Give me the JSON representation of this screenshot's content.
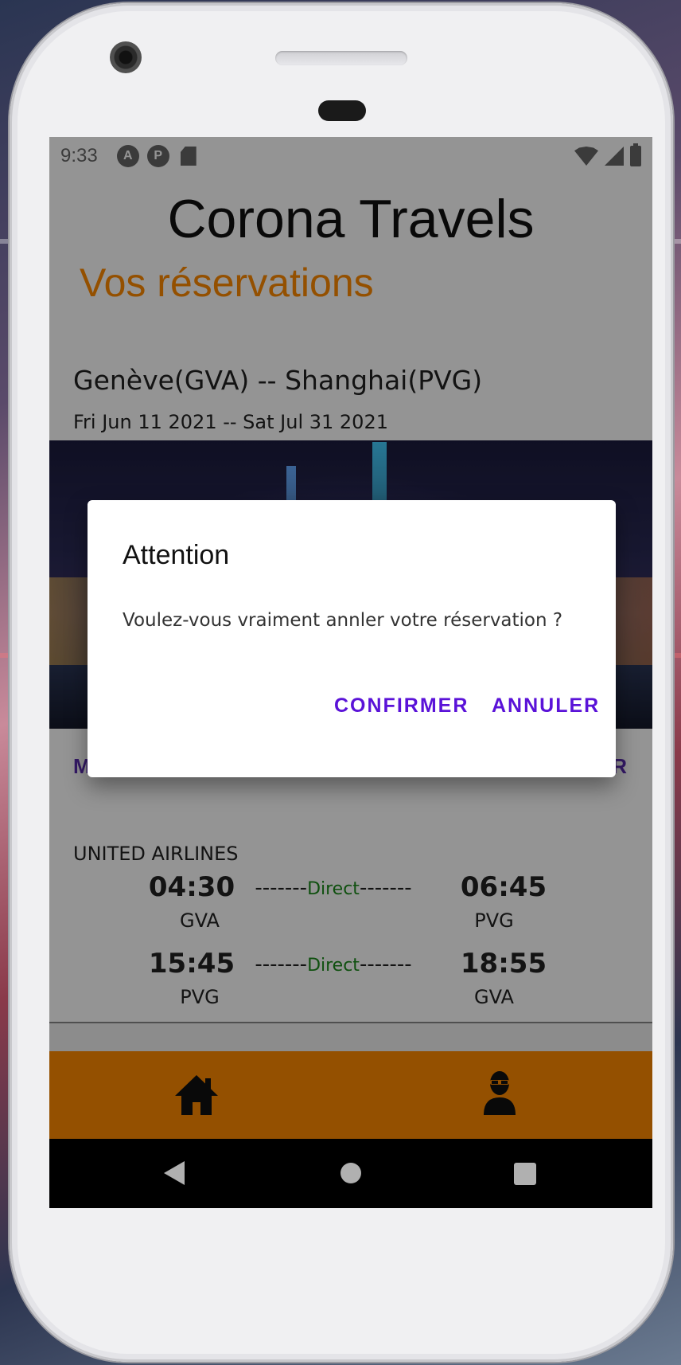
{
  "status_bar": {
    "time": "9:33",
    "notification_icons": [
      "a-letter-icon",
      "p-letter-icon",
      "sd-card-icon"
    ],
    "system_icons": [
      "wifi-icon",
      "signal-icon",
      "battery-icon"
    ]
  },
  "header": {
    "app_title": "Corona Travels",
    "section_title": "Vos réservations",
    "section_title_color": "#ff8a00"
  },
  "reservation": {
    "route": "Genève(GVA) -- Shanghai(PVG)",
    "dates": "Fri Jun 11 2021 -- Sat Jul 31 2021",
    "image": "shanghai-skyline-night",
    "left_action_partial": "M",
    "right_action_partial": "ER"
  },
  "flight": {
    "airline": "UNITED AIRLINES",
    "outbound": {
      "depart_time": "04:30",
      "depart_code": "GVA",
      "arrive_time": "06:45",
      "arrive_code": "PVG",
      "dashes_left": "-------",
      "stop_label": "Direct",
      "dashes_right": "-------"
    },
    "return": {
      "depart_time": "15:45",
      "depart_code": "PVG",
      "arrive_time": "18:55",
      "arrive_code": "GVA",
      "dashes_left": "-------",
      "stop_label": "Direct",
      "dashes_right": "-------"
    }
  },
  "dialog": {
    "title": "Attention",
    "message": "Voulez-vous vraiment annler votre réservation ?",
    "confirm_label": "CONFIRMER",
    "cancel_label": "ANNULER",
    "button_color": "#5a12d8"
  },
  "bottom_nav": {
    "background": "#ff8a00",
    "items": [
      "home-icon",
      "profile-icon"
    ]
  },
  "system_nav": [
    "back-icon",
    "home-circle-icon",
    "recent-apps-icon"
  ]
}
